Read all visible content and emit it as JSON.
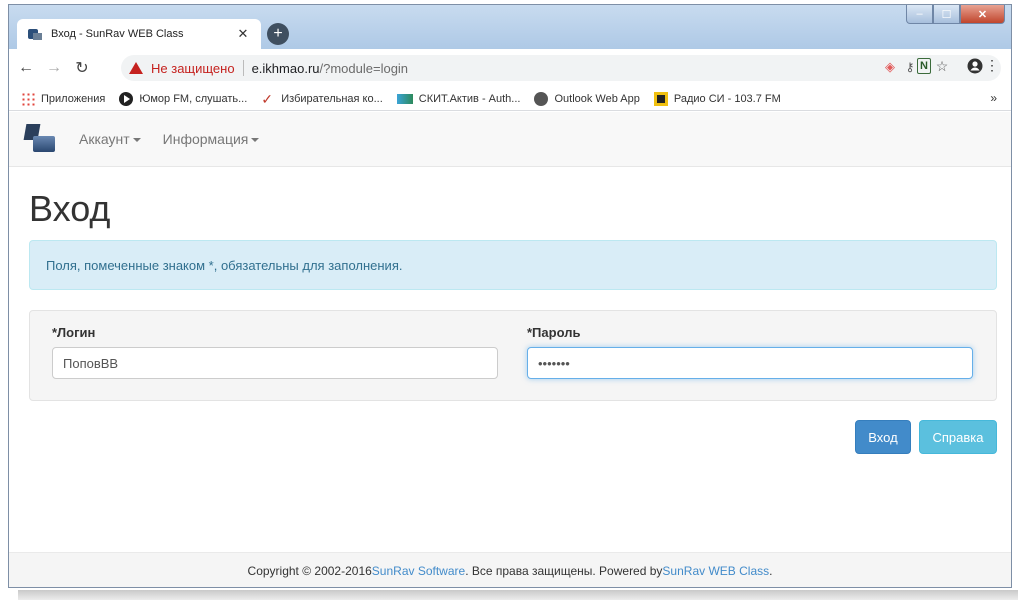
{
  "browser": {
    "tab_title": "Вход - SunRav WEB Class",
    "tab_close": "✕",
    "new_tab": "+",
    "security_warning": "Не защищено",
    "url_host": "e.ikhmao.ru",
    "url_path": "/?module=login",
    "window_controls": {
      "minimize": "–",
      "maximize": "☐",
      "close": "✕"
    }
  },
  "bookmarks": [
    {
      "label": "Приложения",
      "icon": "apps-icon"
    },
    {
      "label": "Юмор FM, слушать...",
      "icon": "play-icon"
    },
    {
      "label": "Избирательная ко...",
      "icon": "checkmark-icon"
    },
    {
      "label": "СКИТ.Актив - Auth...",
      "icon": "skit-icon"
    },
    {
      "label": "Outlook Web App",
      "icon": "globe-icon"
    },
    {
      "label": "Радио СИ - 103.7 FM",
      "icon": "radio-icon"
    }
  ],
  "bookmarks_more": "»",
  "navbar": {
    "menu_account": "Аккаунт",
    "menu_info": "Информация"
  },
  "page": {
    "title": "Вход",
    "alert": "Поля, помеченные знаком *, обязательны для заполнения.",
    "login_label": "*Логин",
    "login_value": "ПоповВВ",
    "password_label": "*Пароль",
    "password_value": "•••••••",
    "login_button": "Вход",
    "help_button": "Справка"
  },
  "footer": {
    "copyright": "Copyright © 2002-2016 ",
    "company_link": "SunRav Software",
    "middle": ". Все права защищены. Powered by ",
    "product_link": "SunRav WEB Class",
    "end": "."
  },
  "colors": {
    "primary": "#428bca",
    "info": "#5bc0de",
    "alert_bg": "#d9edf7",
    "warning_red": "#c5221f"
  }
}
